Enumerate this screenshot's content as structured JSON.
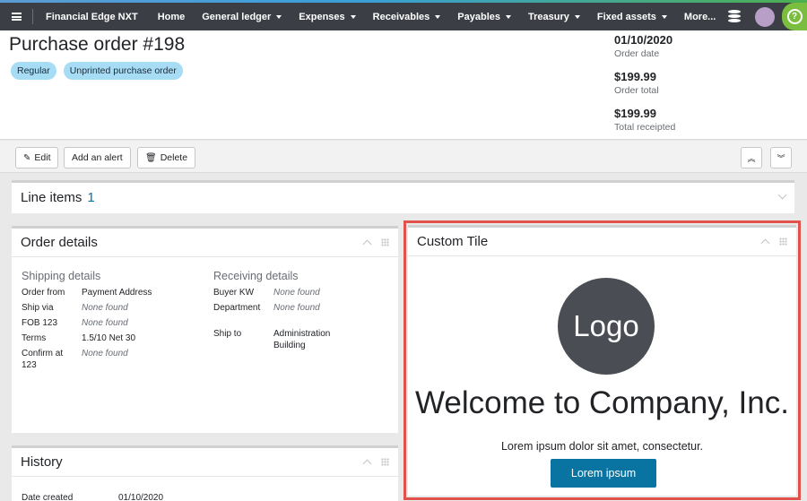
{
  "nav": {
    "app_name": "Financial Edge NXT",
    "items": [
      {
        "label": "Home",
        "dropdown": false
      },
      {
        "label": "General ledger",
        "dropdown": true
      },
      {
        "label": "Expenses",
        "dropdown": true
      },
      {
        "label": "Receivables",
        "dropdown": true
      },
      {
        "label": "Payables",
        "dropdown": true
      },
      {
        "label": "Treasury",
        "dropdown": true
      },
      {
        "label": "Fixed assets",
        "dropdown": true
      },
      {
        "label": "More...",
        "dropdown": false
      }
    ],
    "help_glyph": "?"
  },
  "header": {
    "title": "Purchase order #198",
    "tags": [
      "Regular",
      "Unprinted purchase order"
    ],
    "summary": [
      {
        "value": "01/10/2020",
        "label": "Order date"
      },
      {
        "value": "$199.99",
        "label": "Order total"
      },
      {
        "value": "$199.99",
        "label": "Total receipted"
      }
    ]
  },
  "toolbar": {
    "edit_label": "Edit",
    "alert_label": "Add an alert",
    "delete_label": "Delete"
  },
  "line_items": {
    "title": "Line items",
    "count": "1"
  },
  "order_details": {
    "title": "Order details",
    "shipping": {
      "title": "Shipping details",
      "rows": [
        {
          "key": "Order from",
          "value": "Payment Address",
          "not_found": false
        },
        {
          "key": "Ship via",
          "value": "None found",
          "not_found": true
        },
        {
          "key": "FOB 123",
          "value": "None found",
          "not_found": true
        },
        {
          "key": "Terms",
          "value": "1.5/10 Net 30",
          "not_found": false
        },
        {
          "key": "Confirm at 123",
          "value": "None found",
          "not_found": true
        }
      ]
    },
    "receiving": {
      "title": "Receiving details",
      "rows": [
        {
          "key": "Buyer KW",
          "value": "None found",
          "not_found": true
        },
        {
          "key": "Department",
          "value": "None found",
          "not_found": true
        },
        {
          "key": "Ship to",
          "value": "Administration Building",
          "not_found": false
        }
      ]
    }
  },
  "history": {
    "title": "History",
    "rows": [
      {
        "key": "Date created",
        "value": "01/10/2020"
      }
    ]
  },
  "custom_tile": {
    "title": "Custom Tile",
    "logo_text": "Logo",
    "welcome": "Welcome to Company, Inc.",
    "lorem": "Lorem ipsum dolor sit amet, consectetur.",
    "button_label": "Lorem ipsum"
  },
  "colors": {
    "nav_bg": "#3b3f45",
    "accent_blue": "#0974a1",
    "tag_bg": "#a6ddf5",
    "help_green": "#7abd3f",
    "highlight_red": "#e0524b"
  }
}
